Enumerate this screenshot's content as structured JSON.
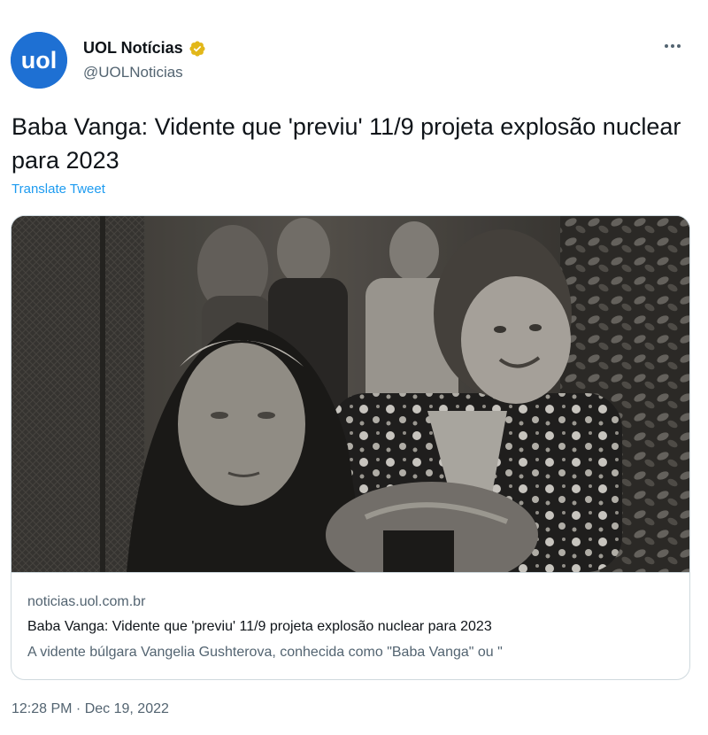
{
  "author": {
    "display_name": "UOL Notícias",
    "handle": "@UOLNoticias",
    "avatar_text": "uol",
    "avatar_icon": "uol-logo-icon",
    "verified_icon": "verified-badge-icon",
    "avatar_color": "#1e70d3",
    "verified_color": "#e2b719"
  },
  "menu": {
    "more_icon": "more-options-icon"
  },
  "tweet": {
    "text": "Baba Vanga: Vidente que 'previu' 11/9 projeta explosão nuclear para 2023",
    "translate_label": "Translate Tweet",
    "timestamp": "12:28 PM · Dec 19, 2022"
  },
  "card": {
    "domain": "noticias.uol.com.br",
    "title": "Baba Vanga: Vidente que 'previu' 11/9 projeta explosão nuclear para 2023",
    "description": "A vidente búlgara Vangelia Gushterova, conhecida como \"Baba Vanga\" ou \""
  },
  "colors": {
    "text_primary": "#0f1419",
    "text_secondary": "#536471",
    "link": "#1d9bf0",
    "border": "#cfd9de"
  }
}
